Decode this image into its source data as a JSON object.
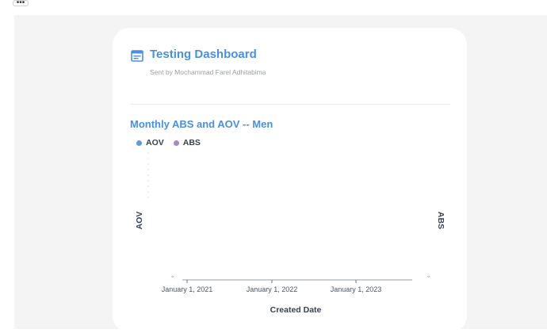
{
  "toolbar": {
    "more_label": "•••"
  },
  "dashboard": {
    "title": "Testing Dashboard",
    "sent_by": "Sent by Mochammad Farel Adhitabima",
    "icon": "dashboard-card-icon",
    "accent": "#4a90e2"
  },
  "chart_data": {
    "type": "line",
    "title": "Monthly ABS and AOV -- Men",
    "xlabel": "Created Date",
    "ylabel_left": "AOV",
    "ylabel_right": "ABS",
    "x_ticks": [
      "January 1, 2021",
      "January 1, 2022",
      "January 1, 2023"
    ],
    "series": [
      {
        "name": "AOV",
        "color": "#5a9be0",
        "values": []
      },
      {
        "name": "ABS",
        "color": "#a989c5",
        "values": []
      }
    ],
    "grid": false,
    "legend_position": "top-left"
  }
}
